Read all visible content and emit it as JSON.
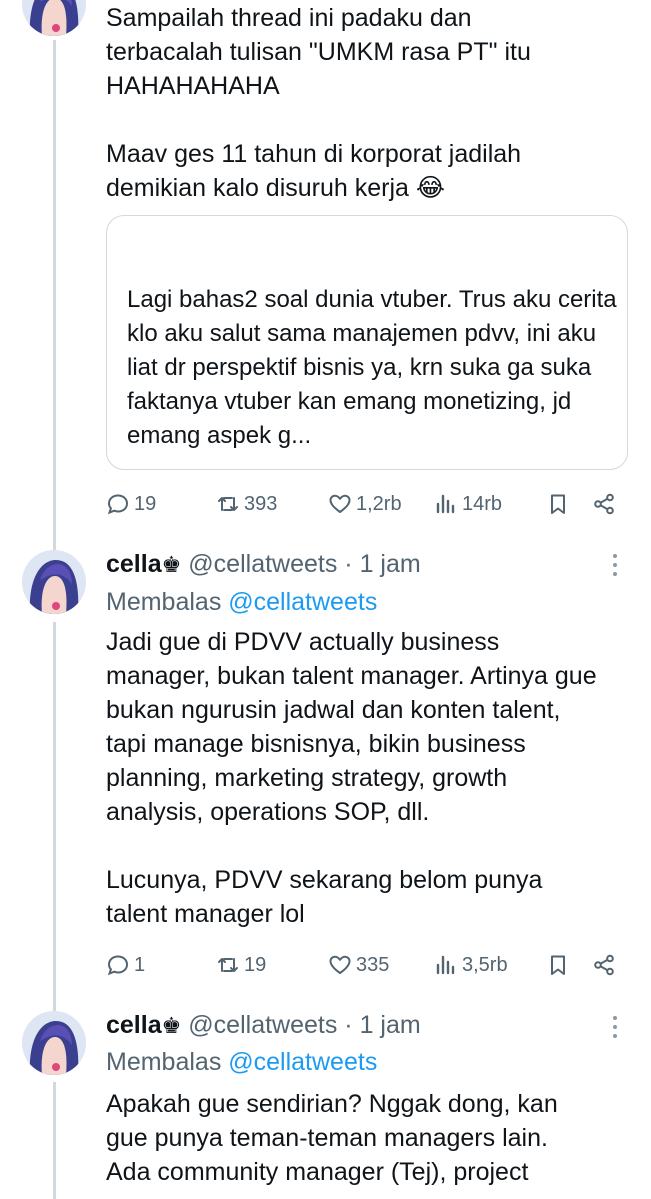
{
  "tweet1": {
    "text": "Sampailah thread ini padaku dan\nterbacalah tulisan \"UMKM rasa PT\" itu\nHAHAHAHAHA\n\nMaav ges 11 tahun di korporat jadilah\ndemikian kalo disuruh kerja 😂",
    "quote_text": "Lagi bahas2 soal dunia vtuber. Trus aku cerita klo aku salut sama manajemen pdvv, ini aku liat dr perspektif bisnis ya, krn suka ga suka faktanya vtuber kan emang monetizing, jd emang aspek g...",
    "replies": "19",
    "reposts": "393",
    "likes": "1,2rb",
    "views": "14rb"
  },
  "tweet2": {
    "name": "cella",
    "name_icon": "♚",
    "handle": "@cellatweets",
    "time": " · 1 jam",
    "reply_prefix": "Membalas ",
    "reply_handle": "@cellatweets",
    "text": "Jadi gue di PDVV actually business\nmanager, bukan talent manager. Artinya gue\nbukan ngurusin jadwal dan konten talent,\ntapi manage bisnisnya, bikin business\nplanning, marketing strategy, growth\nanalysis, operations SOP, dll.\n\nLucunya, PDVV sekarang belom punya\ntalent manager lol",
    "replies": "1",
    "reposts": "19",
    "likes": "335",
    "views": "3,5rb"
  },
  "tweet3": {
    "name": "cella",
    "name_icon": "♚",
    "handle": "@cellatweets",
    "time": " · 1 jam",
    "reply_prefix": "Membalas ",
    "reply_handle": "@cellatweets",
    "text": "Apakah gue sendirian? Nggak dong, kan\ngue punya teman-teman managers lain.\nAda community manager (Tej), project"
  },
  "colors": {
    "text": "#0f1419",
    "muted": "#536471",
    "link": "#1d9bf0",
    "border": "#cfd9de"
  }
}
